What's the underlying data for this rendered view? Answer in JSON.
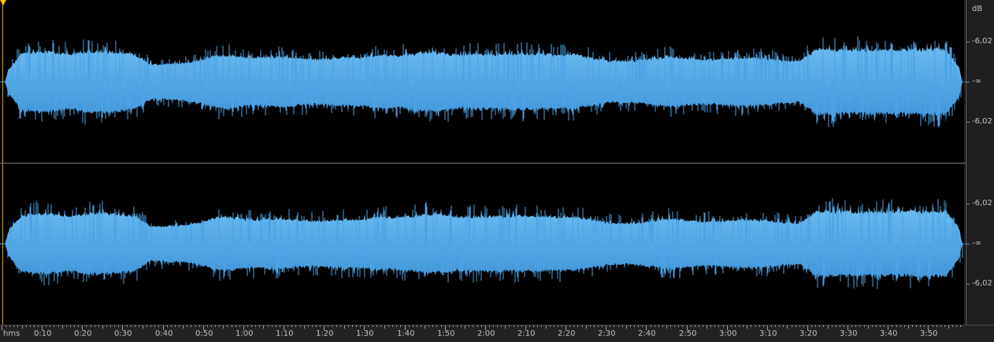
{
  "db_ruler": {
    "unit_label": "dB",
    "labels": [
      "-6,02",
      "-∞",
      "-6,02",
      "-6,02",
      "-∞",
      "-6,02"
    ]
  },
  "time_ruler": {
    "unit_label": "hms",
    "labels": [
      "0:10",
      "0:20",
      "0:30",
      "0:40",
      "0:50",
      "1:00",
      "1:10",
      "1:20",
      "1:30",
      "1:40",
      "1:50",
      "2:00",
      "2:10",
      "2:20",
      "2:30",
      "2:40",
      "2:50",
      "3:00",
      "3:10",
      "3:20",
      "3:30",
      "3:40",
      "3:50"
    ]
  },
  "waveform": {
    "color": "#4aa3e6",
    "color_light": "#6cbdf2",
    "envelope": [
      0.2,
      0.82,
      0.88,
      0.86,
      0.8,
      0.88,
      0.9,
      0.86,
      0.8,
      0.5,
      0.52,
      0.55,
      0.62,
      0.76,
      0.78,
      0.7,
      0.72,
      0.74,
      0.7,
      0.66,
      0.68,
      0.72,
      0.7,
      0.78,
      0.76,
      0.8,
      0.86,
      0.84,
      0.78,
      0.8,
      0.8,
      0.8,
      0.82,
      0.8,
      0.78,
      0.8,
      0.72,
      0.62,
      0.6,
      0.62,
      0.68,
      0.74,
      0.68,
      0.66,
      0.66,
      0.7,
      0.7,
      0.68,
      0.62,
      0.6,
      0.96,
      0.94,
      0.94,
      0.92,
      0.94,
      0.92,
      0.96,
      0.94,
      0.95,
      0.3
    ],
    "channels": 2
  }
}
